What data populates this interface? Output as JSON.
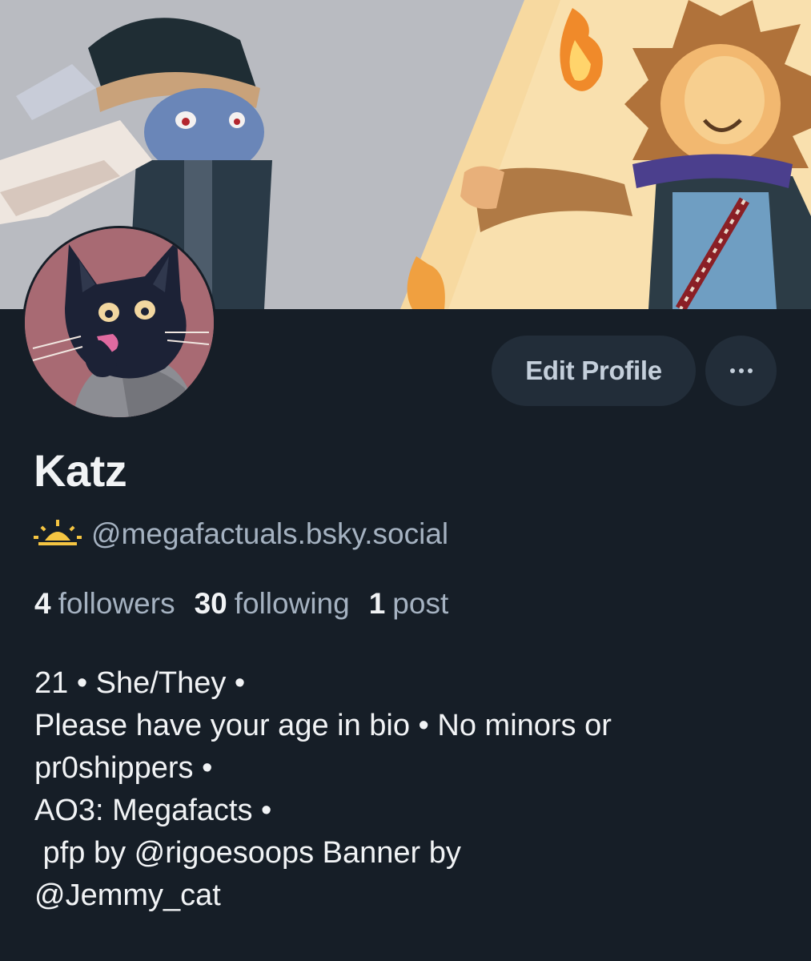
{
  "profile": {
    "display_name": "Katz",
    "handle": "@megafactuals.bsky.social",
    "handle_icon": "sun-icon",
    "stats": [
      {
        "count": "4",
        "label": "followers"
      },
      {
        "count": "30",
        "label": "following"
      },
      {
        "count": "1",
        "label": "post"
      }
    ],
    "bio_lines": [
      "21 • She/They •",
      "Please have your age in bio • No minors or",
      "pr0shippers •",
      "AO3: Megafacts •",
      " pfp by @rigoesoops Banner by",
      "@Jemmy_cat"
    ]
  },
  "actions": {
    "edit_label": "Edit Profile",
    "more_icon": "more-horizontal-icon"
  },
  "colors": {
    "background": "#161e27",
    "button_bg": "#222d39",
    "muted_text": "#a5b2c1",
    "primary_text": "#f1f3f5",
    "accent_sun": "#f5c542"
  }
}
